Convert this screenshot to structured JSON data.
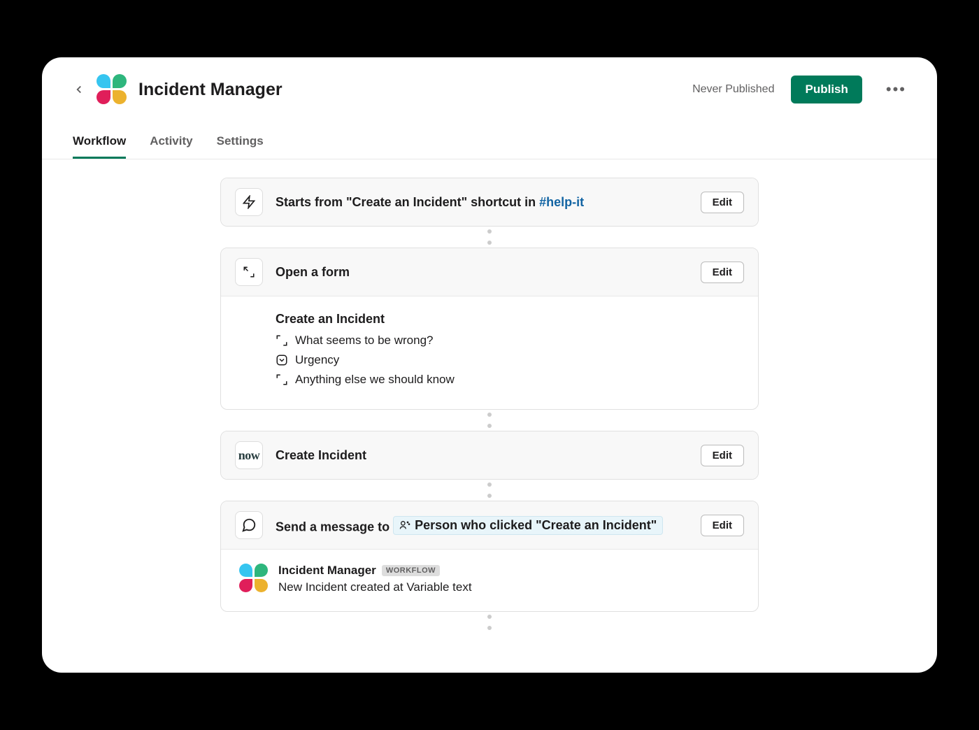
{
  "header": {
    "title": "Incident Manager",
    "publish_status": "Never Published",
    "publish_button": "Publish"
  },
  "tabs": [
    {
      "label": "Workflow",
      "active": true
    },
    {
      "label": "Activity",
      "active": false
    },
    {
      "label": "Settings",
      "active": false
    }
  ],
  "steps": {
    "trigger": {
      "title_prefix": "Starts from \"Create an Incident\" shortcut in ",
      "channel": "#help-it",
      "edit": "Edit"
    },
    "form": {
      "title": "Open a form",
      "edit": "Edit",
      "form_name": "Create an Incident",
      "fields": [
        {
          "type": "text",
          "label": "What seems to be wrong?"
        },
        {
          "type": "select",
          "label": "Urgency"
        },
        {
          "type": "text",
          "label": "Anything else we should know"
        }
      ]
    },
    "servicenow": {
      "title": "Create Incident",
      "edit": "Edit"
    },
    "message": {
      "title_prefix": "Send a message to ",
      "variable_label": "Person who clicked \"Create an Incident\"",
      "edit": "Edit",
      "sender_name": "Incident Manager",
      "sender_badge": "WORKFLOW",
      "body_text": "New Incident created at Variable text"
    }
  }
}
